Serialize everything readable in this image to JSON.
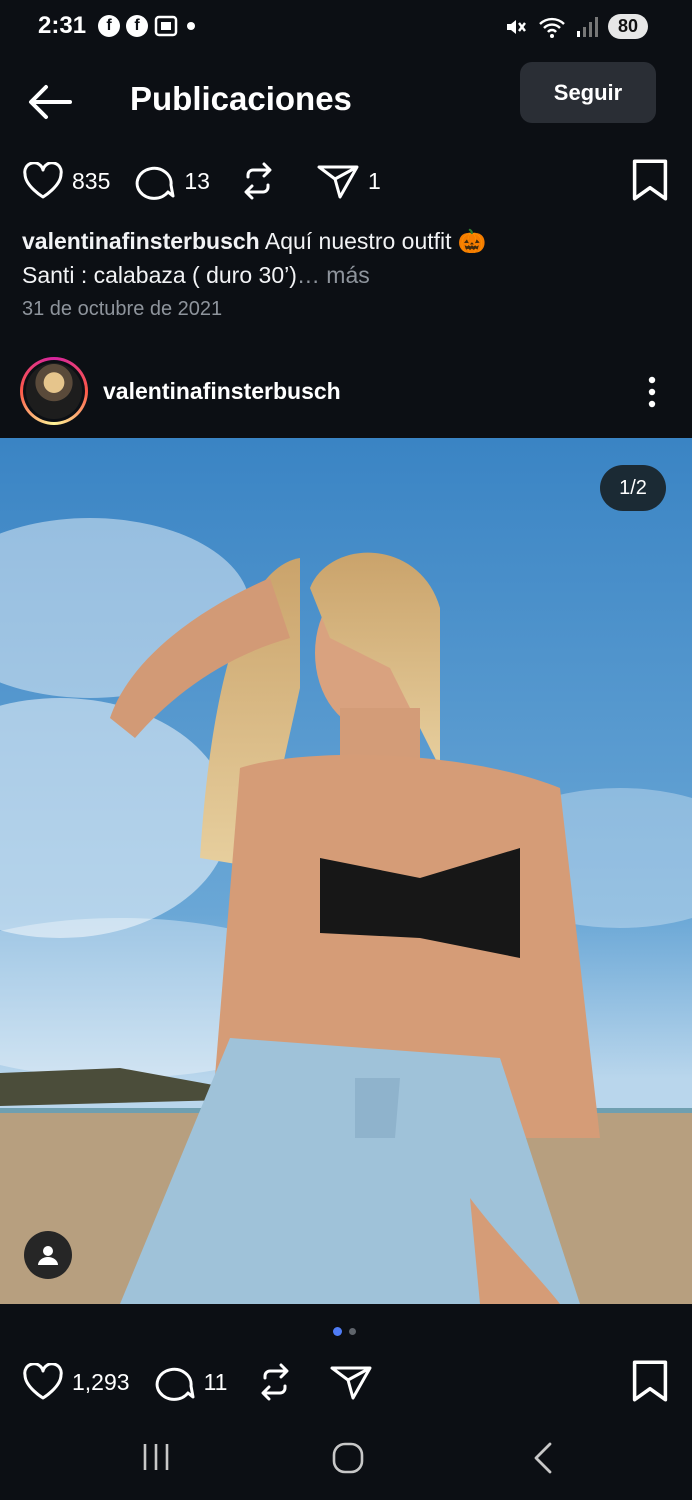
{
  "status_bar": {
    "time": "2:31",
    "battery": "80",
    "notification_icons": [
      "facebook-icon",
      "facebook-icon",
      "screenshot-icon",
      "dot-icon"
    ],
    "system_icons": [
      "mute-icon",
      "wifi-icon",
      "signal-icon"
    ]
  },
  "header": {
    "title": "Publicaciones",
    "follow_label": "Seguir"
  },
  "previous_post": {
    "likes": "835",
    "comments": "13",
    "shares": "1",
    "caption_user": "valentinafinsterbusch",
    "caption_text_line1": " Aquí nuestro outfit 🎃",
    "caption_text_line2": "Santi : calabaza ( duro 30’)",
    "caption_more": "… más",
    "date": "31 de octubre de 2021"
  },
  "post": {
    "author": "valentinafinsterbusch",
    "image_counter": "1/2",
    "likes": "1,293",
    "comments": "11",
    "carousel_total": 2,
    "carousel_active": 1
  },
  "colors": {
    "background": "#0c0f14",
    "accent_dot": "#4f7cf6",
    "muted_text": "#8e949c"
  }
}
